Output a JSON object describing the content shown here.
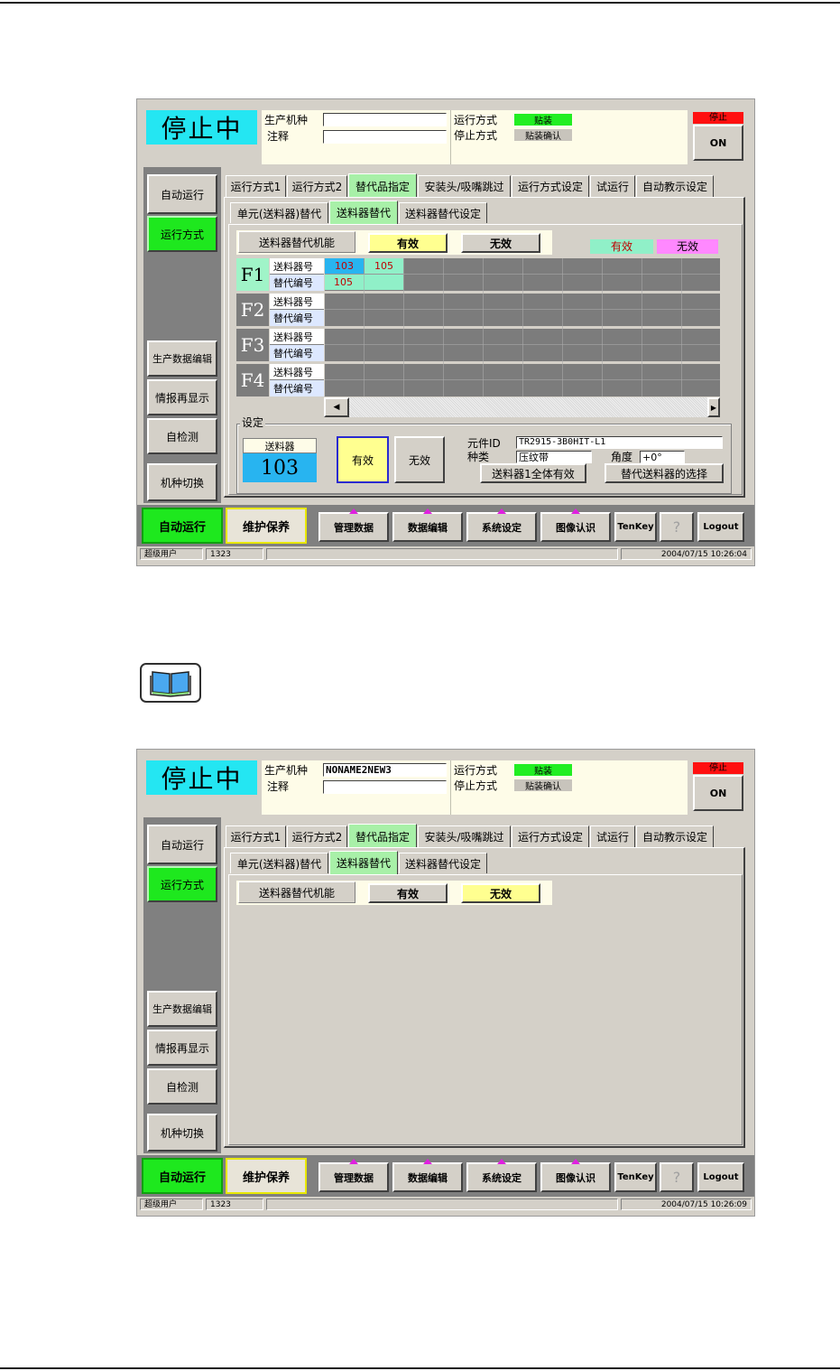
{
  "screen_a": {
    "status": "停止中",
    "model_label": "生产机种",
    "model_value": "",
    "note_label": "注释",
    "note_value": "",
    "run_mode_label": "运行方式",
    "run_mode_value": "贴装",
    "stop_mode_label": "停止方式",
    "stop_mode_value": "贴装确认",
    "stop_indicator": "停止",
    "on_button": "ON",
    "side": [
      "自动运行",
      "运行方式",
      "生产数据编辑",
      "情报再显示",
      "自检测",
      "机种切换"
    ],
    "tabs": [
      "运行方式1",
      "运行方式2",
      "替代品指定",
      "安装头/吸嘴跳过",
      "运行方式设定",
      "试运行",
      "自动教示设定"
    ],
    "subtabs": [
      "单元(送料器)替代",
      "送料器替代",
      "送料器替代设定"
    ],
    "function_label": "送料器替代机能",
    "valid_btn": "有效",
    "invalid_btn": "无效",
    "legend_valid": "有效",
    "legend_invalid": "无效",
    "feeders": [
      {
        "label": "F1",
        "row1": "送料器号",
        "row2": "替代编号",
        "row1_values": [
          "103",
          "105"
        ],
        "row2_values": [
          "105"
        ]
      },
      {
        "label": "F2",
        "row1": "送料器号",
        "row2": "替代编号",
        "row1_values": [],
        "row2_values": []
      },
      {
        "label": "F3",
        "row1": "送料器号",
        "row2": "替代编号",
        "row1_values": [],
        "row2_values": []
      },
      {
        "label": "F4",
        "row1": "送料器号",
        "row2": "替代编号",
        "row1_values": [],
        "row2_values": []
      }
    ],
    "settings_title": "设定",
    "feeder_label": "送料器",
    "feeder_number": "103",
    "set_valid": "有效",
    "set_invalid": "无效",
    "part_id_label": "元件ID",
    "part_id_value": "TR2915-3B0HIT-L1",
    "kind_label": "种类",
    "kind_value": "压纹带",
    "angle_label": "角度",
    "angle_value": "+0°",
    "all_valid_btn": "送料器1全体有效",
    "select_feeder_btn": "替代送料器的选择",
    "bottom": [
      "自动运行",
      "维护保养",
      "管理数据",
      "数据编辑",
      "系统设定",
      "图像认识",
      "TenKey",
      "?",
      "Logout"
    ],
    "user": "超级用户",
    "code": "1323",
    "datetime": "2004/07/15 10:26:04"
  },
  "screen_b": {
    "status": "停止中",
    "model_label": "生产机种",
    "model_value": "NONAME2NEW3",
    "note_label": "注释",
    "note_value": "",
    "run_mode_label": "运行方式",
    "run_mode_value": "贴装",
    "stop_mode_label": "停止方式",
    "stop_mode_value": "贴装确认",
    "stop_indicator": "停止",
    "on_button": "ON",
    "side": [
      "自动运行",
      "运行方式",
      "生产数据编辑",
      "情报再显示",
      "自检测",
      "机种切换"
    ],
    "tabs": [
      "运行方式1",
      "运行方式2",
      "替代品指定",
      "安装头/吸嘴跳过",
      "运行方式设定",
      "试运行",
      "自动教示设定"
    ],
    "subtabs": [
      "单元(送料器)替代",
      "送料器替代",
      "送料器替代设定"
    ],
    "function_label": "送料器替代机能",
    "valid_btn": "有效",
    "invalid_btn": "无效",
    "bottom": [
      "自动运行",
      "维护保养",
      "管理数据",
      "数据编辑",
      "系统设定",
      "图像认识",
      "TenKey",
      "?",
      "Logout"
    ],
    "user": "超级用户",
    "code": "1323",
    "datetime": "2004/07/15 10:26:09"
  },
  "icons": {
    "book": "book-icon",
    "help": "question-icon",
    "scroll_left": "arrow-left-icon",
    "scroll_right": "arrow-right-icon"
  },
  "colors": {
    "status_cyan": "#24e6f2",
    "active_green": "#1ee81e",
    "valid_yellow": "#ffff90",
    "legend_mint": "#90f0c8",
    "legend_pink": "#ff88ff",
    "stop_red": "#ff1010",
    "feeder_blue": "#28b4f0"
  }
}
